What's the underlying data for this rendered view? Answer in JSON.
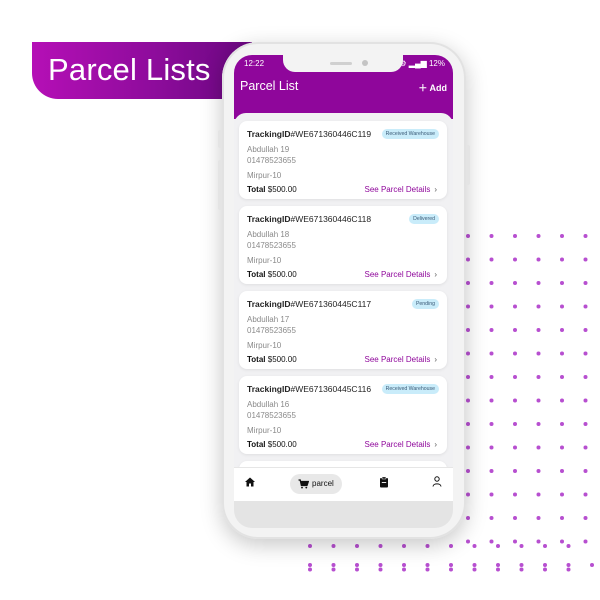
{
  "banner": {
    "title": "Parcel Lists"
  },
  "status_bar": {
    "time": "12:22",
    "battery": "12%"
  },
  "app_bar": {
    "title": "Parcel List",
    "add_label": "Add"
  },
  "parcels": [
    {
      "tracking_label": "TrackingID",
      "tracking_id": "#WE671360446C119",
      "status": "Received Warehouse",
      "name": "Abdullah 19",
      "phone": "01478523655",
      "area": "Mirpur-10",
      "total_label": "Total",
      "total_value": "$500.00",
      "details_label": "See Parcel Details"
    },
    {
      "tracking_label": "TrackingID",
      "tracking_id": "#WE671360446C118",
      "status": "Delivered",
      "name": "Abdullah 18",
      "phone": "01478523655",
      "area": "Mirpur-10",
      "total_label": "Total",
      "total_value": "$500.00",
      "details_label": "See Parcel Details"
    },
    {
      "tracking_label": "TrackingID",
      "tracking_id": "#WE671360445C117",
      "status": "Pending",
      "name": "Abdullah 17",
      "phone": "01478523655",
      "area": "Mirpur-10",
      "total_label": "Total",
      "total_value": "$500.00",
      "details_label": "See Parcel Details"
    },
    {
      "tracking_label": "TrackingID",
      "tracking_id": "#WE671360445C116",
      "status": "Received Warehouse",
      "name": "Abdullah 16",
      "phone": "01478523655",
      "area": "Mirpur-10",
      "total_label": "Total",
      "total_value": "$500.00",
      "details_label": "See Parcel Details"
    }
  ],
  "bottom_nav": {
    "items": [
      {
        "icon": "home-icon"
      },
      {
        "icon": "cart-icon",
        "label": "parcel",
        "active": true
      },
      {
        "icon": "clipboard-icon"
      },
      {
        "icon": "user-icon"
      }
    ]
  },
  "colors": {
    "brand": "#8f069b",
    "banner_start": "#b50fb6",
    "banner_end": "#6a0780",
    "badge_bg": "#c9ecfa",
    "dots": "#b74fd0"
  }
}
